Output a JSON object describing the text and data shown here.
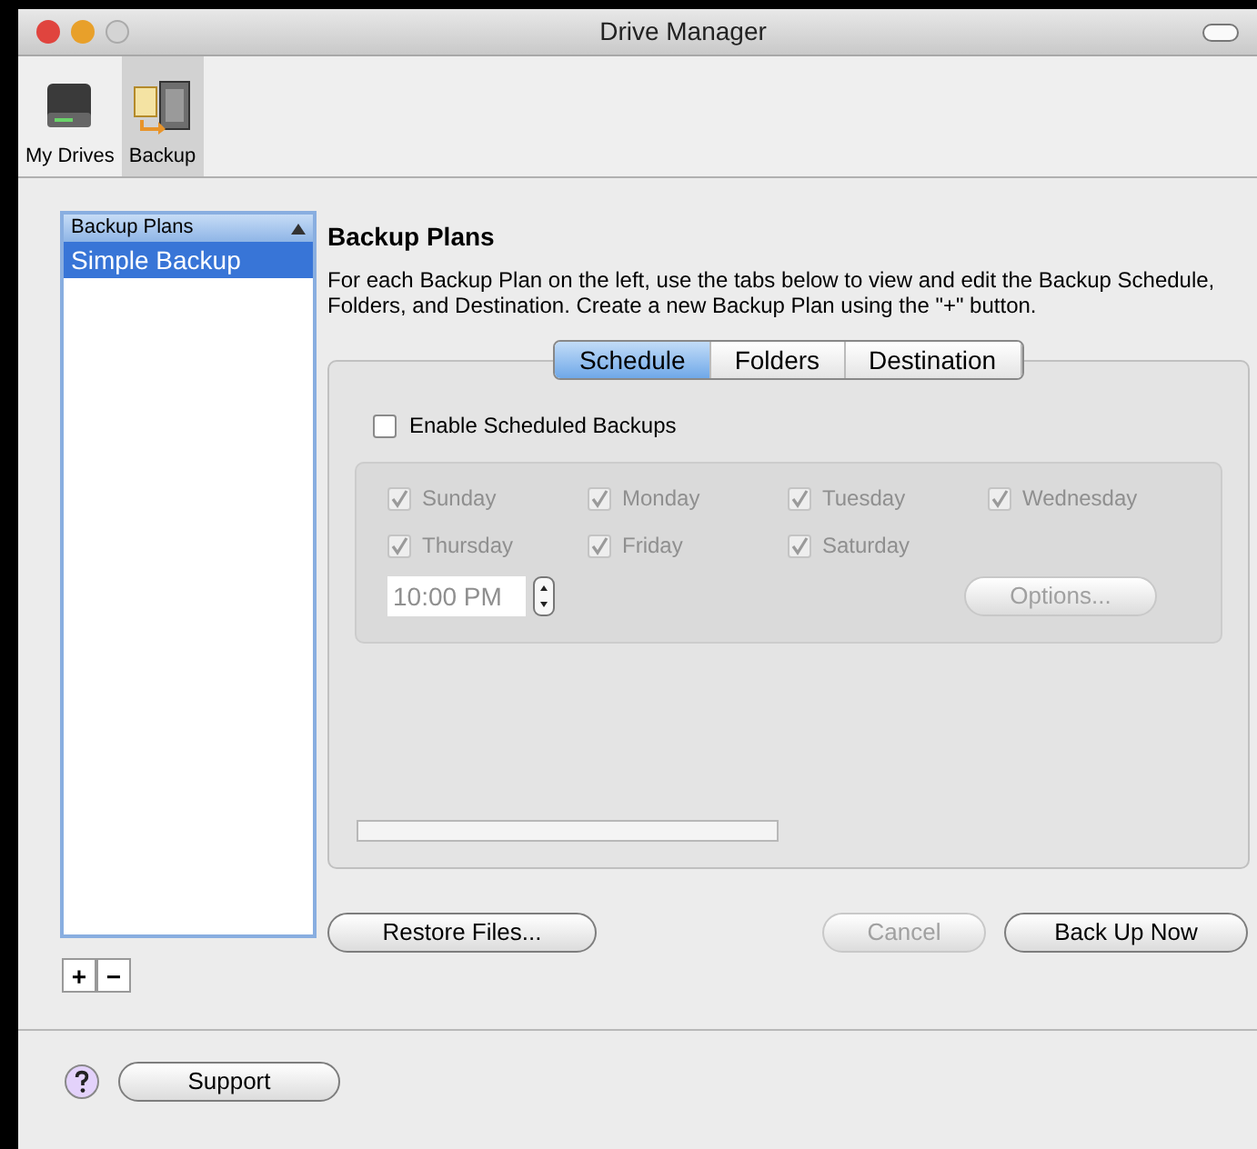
{
  "window": {
    "title": "Drive Manager"
  },
  "toolbar": [
    {
      "label": "My Drives",
      "kind": "drive",
      "selected": false
    },
    {
      "label": "Backup",
      "kind": "backup",
      "selected": true
    }
  ],
  "plans": {
    "header": "Backup Plans",
    "items": [
      {
        "label": "Simple Backup",
        "selected": true
      }
    ]
  },
  "list_buttons": [
    "+",
    "−"
  ],
  "heading": "Backup Plans",
  "description": "For each Backup Plan on the left, use the tabs below to view and edit the Backup Schedule, Folders, and Destination. Create a new Backup Plan using the \"+\" button.",
  "tabs": [
    {
      "label": "Schedule",
      "selected": true
    },
    {
      "label": "Folders",
      "selected": false
    },
    {
      "label": "Destination",
      "selected": false
    }
  ],
  "enable": {
    "label": "Enable Scheduled Backups",
    "checked": false
  },
  "days": [
    {
      "label": "Sunday",
      "checked": true,
      "disabled": true
    },
    {
      "label": "Monday",
      "checked": true,
      "disabled": true
    },
    {
      "label": "Tuesday",
      "checked": true,
      "disabled": true
    },
    {
      "label": "Wednesday",
      "checked": true,
      "disabled": true
    },
    {
      "label": "Thursday",
      "checked": true,
      "disabled": true
    },
    {
      "label": "Friday",
      "checked": true,
      "disabled": true
    },
    {
      "label": "Saturday",
      "checked": true,
      "disabled": true
    }
  ],
  "time": {
    "value": "10:00 PM",
    "disabled": true
  },
  "options_button": {
    "label": "Options...",
    "disabled": true
  },
  "buttons": [
    {
      "label": "Restore Files...",
      "disabled": false
    },
    {
      "label": "Cancel",
      "disabled": true
    },
    {
      "label": "Back Up Now",
      "disabled": false
    }
  ],
  "support": {
    "label": "Support"
  }
}
